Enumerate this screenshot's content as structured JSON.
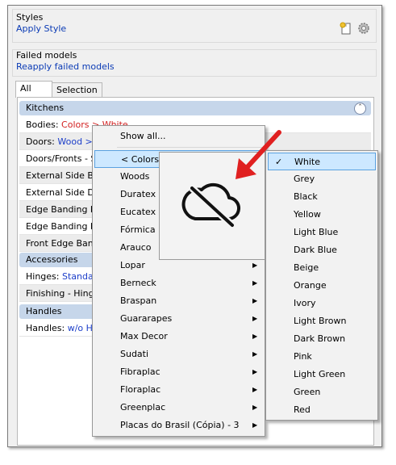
{
  "styles": {
    "title": "Styles",
    "link": "Apply Style"
  },
  "failed": {
    "title": "Failed models",
    "link": "Reapply failed models"
  },
  "tabs": [
    {
      "label": "All"
    },
    {
      "label": "Selection"
    }
  ],
  "kitchens": {
    "header": "Kitchens",
    "rows": [
      {
        "label": "Bodies:",
        "value": "Colors > White"
      },
      {
        "label": "Doors:",
        "value": "Wood > S"
      },
      {
        "label": "Doors/Fronts - S",
        "value": ""
      },
      {
        "label": "External Side Bo",
        "value": ""
      },
      {
        "label": "External Side Do",
        "value": ""
      },
      {
        "label": "Edge Banding Bo",
        "value": ""
      },
      {
        "label": "Edge Banding Do",
        "value": ""
      },
      {
        "label": "Front Edge Band",
        "value": ""
      }
    ]
  },
  "accessories": {
    "header": "Accessories",
    "rows": [
      {
        "label": "Hinges:",
        "value": "Standar"
      },
      {
        "label": "Finishing - Hinge",
        "value": ""
      }
    ]
  },
  "handles": {
    "header": "Handles",
    "rows": [
      {
        "label": "Handles:",
        "value": "w/o Ha"
      }
    ]
  },
  "menu": {
    "show_all": "Show all...",
    "items": [
      "< Colors",
      "Woods",
      "Duratex",
      "Eucatex",
      "Fórmica",
      "Arauco",
      "Lopar",
      "Berneck",
      "Braspan",
      "Guararapes",
      "Max Decor",
      "Sudati",
      "Fibraplac",
      "Floraplac",
      "Greenplac",
      "Placas do Brasil (Cópia) - 3"
    ]
  },
  "colors_menu": {
    "items": [
      "White",
      "Grey",
      "Black",
      "Yellow",
      "Light Blue",
      "Dark Blue",
      "Beige",
      "Orange",
      "Ivory",
      "Light Brown",
      "Dark Brown",
      "Pink",
      "Light Green",
      "Green",
      "Red"
    ],
    "selected": "White"
  },
  "icons": {
    "new_style": "new-document-icon",
    "settings": "gear-icon",
    "tooltip": "cloud-off-icon",
    "pointer": "red-arrow-icon"
  },
  "colors": {
    "accent_red": "#e02020",
    "header_blue": "#c6d6ea",
    "link_blue": "#0b3bb5"
  }
}
